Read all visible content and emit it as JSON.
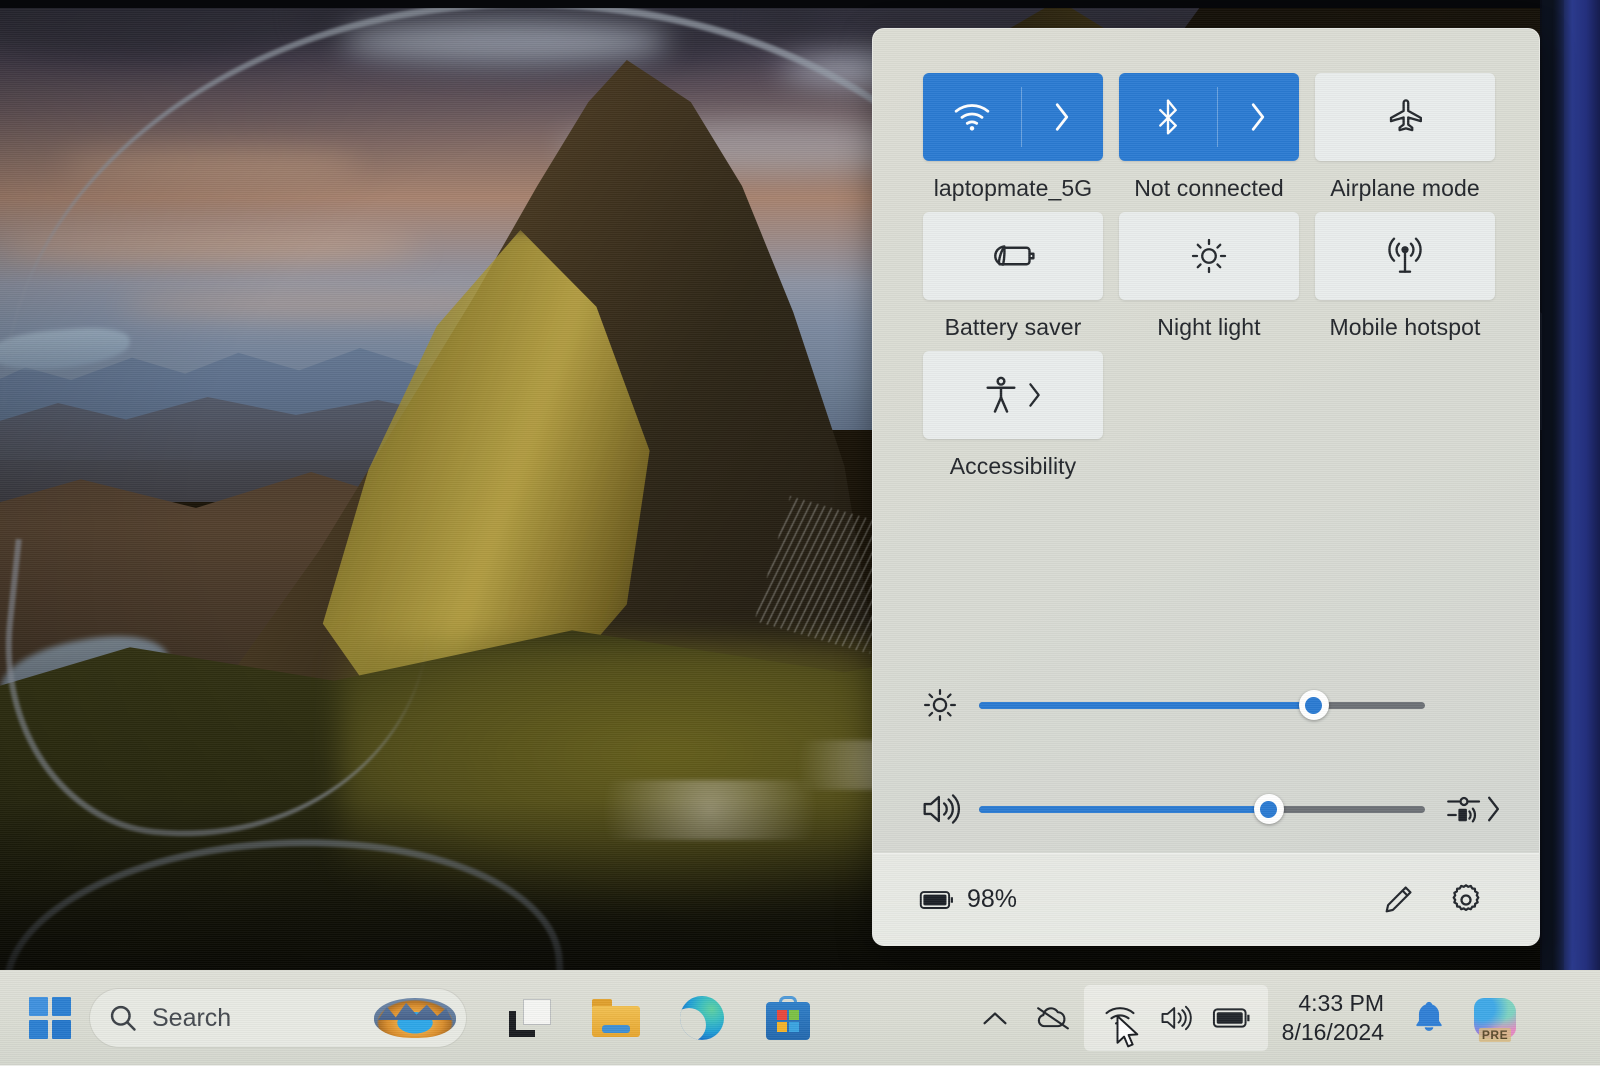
{
  "desktop": {
    "wallpaper_name": "quiraing-isle-of-skye-wallpaper"
  },
  "quick_settings": {
    "tiles": [
      {
        "id": "wifi",
        "label": "laptopmate_5G",
        "icon": "wifi-icon",
        "state": "on",
        "has_chevron": true
      },
      {
        "id": "bluetooth",
        "label": "Not connected",
        "icon": "bluetooth-icon",
        "state": "on",
        "has_chevron": true
      },
      {
        "id": "airplane",
        "label": "Airplane mode",
        "icon": "airplane-icon",
        "state": "off",
        "has_chevron": false
      },
      {
        "id": "battery-saver",
        "label": "Battery saver",
        "icon": "battery-saver-icon",
        "state": "off",
        "has_chevron": false
      },
      {
        "id": "night-light",
        "label": "Night light",
        "icon": "night-light-icon",
        "state": "off",
        "has_chevron": false
      },
      {
        "id": "mobile-hotspot",
        "label": "Mobile hotspot",
        "icon": "mobile-hotspot-icon",
        "state": "off",
        "has_chevron": false
      },
      {
        "id": "accessibility",
        "label": "Accessibility",
        "icon": "accessibility-icon",
        "state": "off",
        "has_chevron": true
      }
    ],
    "sliders": [
      {
        "id": "brightness",
        "icon": "brightness-icon",
        "value": 75,
        "min": 0,
        "max": 100
      },
      {
        "id": "volume",
        "icon": "volume-icon",
        "value": 65,
        "min": 0,
        "max": 100
      }
    ],
    "volume_output_selector": {
      "icon": "audio-output-icon",
      "chevron": "›"
    },
    "footer": {
      "battery_icon": "battery-icon",
      "battery_percent": "98%",
      "edit_icon": "pencil-icon",
      "settings_icon": "gear-icon"
    },
    "colors": {
      "accent": "#2a7ad2",
      "panel_bg": "#d9dbd3",
      "tile_bg": "#e9edec",
      "text": "#23262b"
    }
  },
  "taskbar": {
    "start_button": {
      "label": "Start",
      "icon": "windows-logo-icon"
    },
    "search": {
      "icon": "search-icon",
      "placeholder": "Search",
      "value": "",
      "thumbnail": "wallpaper-thumbnail"
    },
    "apps": [
      {
        "id": "task-view",
        "label": "Task view",
        "icon": "task-view-icon"
      },
      {
        "id": "file-explorer",
        "label": "File Explorer",
        "icon": "folder-icon"
      },
      {
        "id": "edge",
        "label": "Microsoft Edge",
        "icon": "edge-icon"
      },
      {
        "id": "microsoft-store",
        "label": "Microsoft Store",
        "icon": "store-icon"
      }
    ],
    "tray": {
      "overflow": {
        "icon": "chevron-up-icon",
        "label": "Show hidden icons"
      },
      "onedrive": {
        "icon": "onedrive-offline-icon",
        "label": "OneDrive"
      },
      "cluster": [
        {
          "id": "network",
          "icon": "wifi-icon",
          "label": "Network"
        },
        {
          "id": "volume",
          "icon": "volume-icon",
          "label": "Volume"
        },
        {
          "id": "battery",
          "icon": "battery-icon",
          "label": "Battery"
        }
      ],
      "cursor": "mouse-cursor"
    },
    "clock": {
      "time": "4:33 PM",
      "date": "8/16/2024"
    },
    "notifications": {
      "icon": "bell-icon",
      "label": "Notifications"
    },
    "copilot": {
      "icon": "copilot-icon",
      "label": "Copilot",
      "badge": "PRE"
    }
  }
}
